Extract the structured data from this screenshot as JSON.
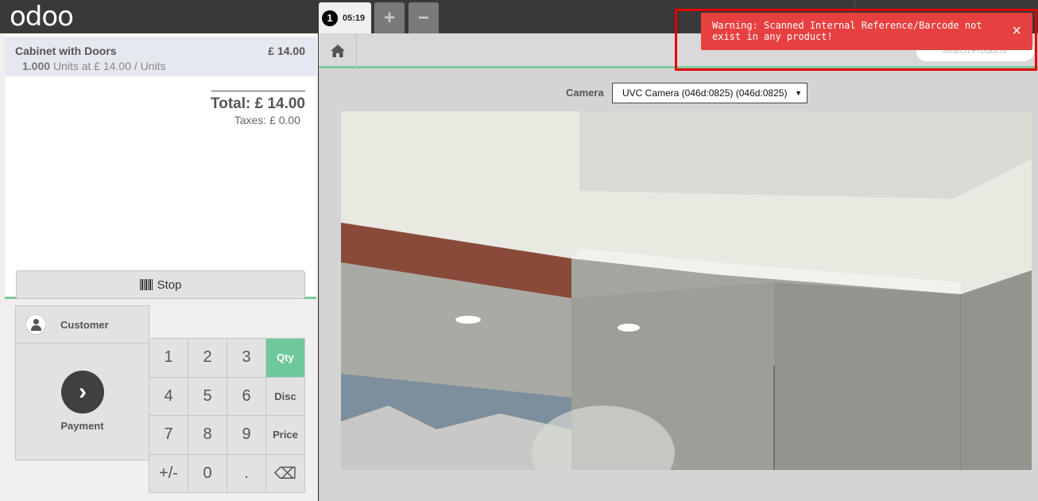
{
  "app": {
    "logo": "odoo"
  },
  "order_tabs": {
    "active": {
      "number": "1",
      "time": "05:19"
    },
    "add_label": "+",
    "remove_label": "−"
  },
  "order": {
    "line": {
      "name": "Cabinet with Doors",
      "price": "£ 14.00",
      "quantity": "1.000",
      "unit_info": "Units at £ 14.00 / Units"
    },
    "total": "Total: £ 14.00",
    "taxes": "Taxes: £ 0.00"
  },
  "controls": {
    "stop_label": "Stop",
    "customer_label": "Customer",
    "payment_label": "Payment"
  },
  "numpad": {
    "keys": [
      "1",
      "2",
      "3",
      "Qty",
      "4",
      "5",
      "6",
      "Disc",
      "7",
      "8",
      "9",
      "Price",
      "+/-",
      "0",
      ".",
      "⌫"
    ],
    "selected_mode": "Qty"
  },
  "product_screen": {
    "search_placeholder": "Search Products",
    "camera_label": "Camera",
    "camera_selected": "UVC Camera (046d:0825) (046d:0825)"
  },
  "notification": {
    "message": "Warning: Scanned Internal Reference/Barcode not exist in any product!",
    "close_label": "×",
    "color": "#e74040"
  },
  "colors": {
    "accent": "#6ec89b",
    "highlight_border": "#e30000"
  }
}
